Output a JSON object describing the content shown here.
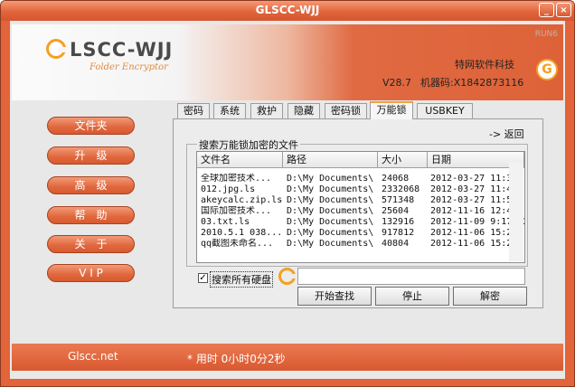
{
  "window": {
    "title": "GLSCC-WJJ"
  },
  "title_buttons": {
    "minimize": "_",
    "close": "×"
  },
  "header": {
    "logo_text": "LSCC-WJJ",
    "logo_subtitle": "Folder Encryptor",
    "run_label": "RUN6",
    "company": "特网软件科技",
    "version": "V28.7",
    "machine_code": "机器码:X1842873116",
    "logo_icon": "G"
  },
  "sidebar": {
    "items": [
      {
        "label": "文件夹"
      },
      {
        "label": "升　级"
      },
      {
        "label": "高　级"
      },
      {
        "label": "帮　助"
      },
      {
        "label": "关　于"
      },
      {
        "label": "V I P"
      }
    ]
  },
  "tabs": [
    {
      "label": "密码"
    },
    {
      "label": "系统"
    },
    {
      "label": "救护"
    },
    {
      "label": "隐藏"
    },
    {
      "label": "密码锁"
    },
    {
      "label": "万能锁",
      "active": true
    },
    {
      "label": "USBKEY"
    }
  ],
  "panel": {
    "back_link": "-> 返回",
    "group_title": "搜索万能锁加密的文件",
    "columns": [
      "文件名",
      "路径",
      "大小",
      "日期"
    ],
    "rows": [
      {
        "name": "全球加密技术...",
        "path": "D:\\My Documents\\",
        "size": "24068",
        "date": "2012-03-27 11:3..."
      },
      {
        "name": "012.jpg.ls",
        "path": "D:\\My Documents\\",
        "size": "2332068",
        "date": "2012-03-27 11:4..."
      },
      {
        "name": "akeycalc.zip.ls",
        "path": "D:\\My Documents\\",
        "size": "571348",
        "date": "2012-03-27 11:5..."
      },
      {
        "name": "国际加密技术...",
        "path": "D:\\My Documents\\",
        "size": "25604",
        "date": "2012-11-16 12:4..."
      },
      {
        "name": "03.txt.ls",
        "path": "D:\\My Documents\\",
        "size": "132916",
        "date": "2012-11-09 9:17:42"
      },
      {
        "name": "2010.5.1 038...",
        "path": "D:\\My Documents\\",
        "size": "917812",
        "date": "2012-11-06 15:2..."
      },
      {
        "name": "qq截图未命名...",
        "path": "D:\\My Documents\\",
        "size": "40804",
        "date": "2012-11-06 15:2..."
      }
    ],
    "search_all_label": "搜索所有硬盘",
    "search_all_checked": "✓",
    "path_value": "",
    "buttons": {
      "start": "开始查找",
      "stop": "停止",
      "decrypt": "解密"
    }
  },
  "status": {
    "site": "Glscc.net",
    "elapsed": "* 用时 0小时0分2秒"
  },
  "colors": {
    "accent": "#e0673d",
    "tab_highlight": "#f0a040",
    "logo_orange": "#f6a01f"
  }
}
